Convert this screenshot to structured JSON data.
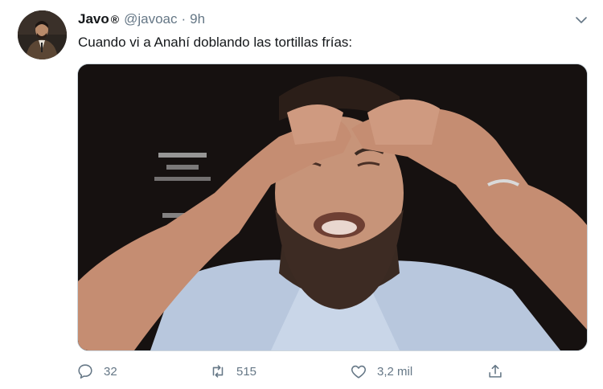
{
  "tweet": {
    "author_name": "Javo",
    "verified_mark": "®",
    "handle": "@javoac",
    "separator": "·",
    "timestamp": "9h",
    "text": "Cuando vi a Anahí doblando las tortillas frías:",
    "media_icon": "photo",
    "menu_icon": "chevron-down-icon"
  },
  "actions": {
    "reply_count": "32",
    "retweet_count": "515",
    "like_count": "3,2 mil",
    "share_icon": "share-icon"
  },
  "colors": {
    "text": "#14171a",
    "muted": "#657786",
    "border": "#ccd6dd"
  }
}
